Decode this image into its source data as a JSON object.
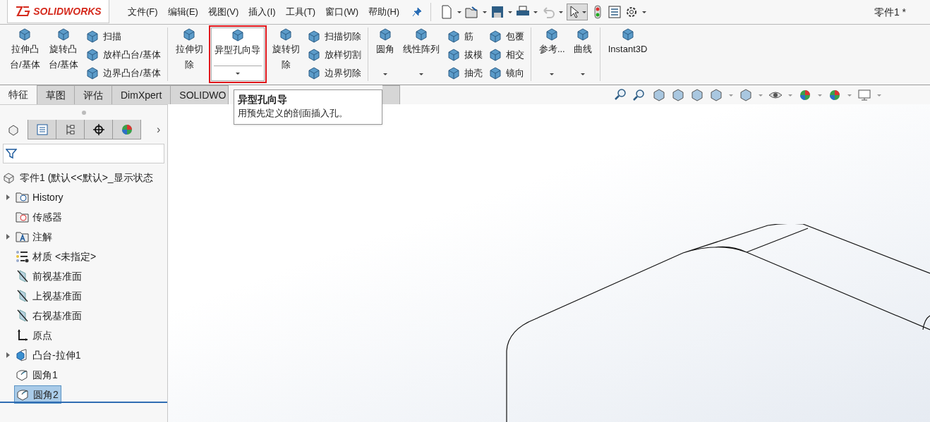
{
  "app": {
    "logo": "SOLIDWORKS",
    "title": "零件1 *"
  },
  "menu": [
    "文件(F)",
    "编辑(E)",
    "视图(V)",
    "插入(I)",
    "工具(T)",
    "窗口(W)",
    "帮助(H)"
  ],
  "ribbon": [
    {
      "kind": "big",
      "lines": [
        "拉伸凸",
        "台/基体"
      ],
      "dropdown": false,
      "hover": false
    },
    {
      "kind": "big",
      "lines": [
        "旋转凸",
        "台/基体"
      ],
      "dropdown": false,
      "hover": false
    },
    {
      "kind": "stack",
      "items": [
        "扫描",
        "放样凸台/基体",
        "边界凸台/基体"
      ]
    },
    {
      "kind": "separator"
    },
    {
      "kind": "big",
      "lines": [
        "拉伸切",
        "除"
      ],
      "dropdown": false,
      "hover": false
    },
    {
      "kind": "big",
      "lines": [
        "异型孔向导"
      ],
      "dropdown": true,
      "hover": true
    },
    {
      "kind": "big",
      "lines": [
        "旋转切",
        "除"
      ],
      "dropdown": false,
      "hover": false
    },
    {
      "kind": "stack",
      "items": [
        "扫描切除",
        "放样切割",
        "边界切除"
      ]
    },
    {
      "kind": "separator"
    },
    {
      "kind": "big",
      "lines": [
        "圆角"
      ],
      "dropdown": true,
      "hover": false
    },
    {
      "kind": "big",
      "lines": [
        "线性阵列"
      ],
      "dropdown": true,
      "hover": false
    },
    {
      "kind": "stack",
      "items": [
        "筋",
        "拔模",
        "抽壳"
      ]
    },
    {
      "kind": "stack",
      "items": [
        "包覆",
        "相交",
        "镜向"
      ]
    },
    {
      "kind": "separator"
    },
    {
      "kind": "big",
      "lines": [
        "参考..."
      ],
      "dropdown": true,
      "hover": false
    },
    {
      "kind": "big",
      "lines": [
        "曲线"
      ],
      "dropdown": true,
      "hover": false
    },
    {
      "kind": "separator"
    },
    {
      "kind": "big",
      "lines": [
        "Instant3D"
      ],
      "dropdown": false,
      "hover": false
    }
  ],
  "tabs": [
    {
      "label": "特征",
      "selected": true
    },
    {
      "label": "草图",
      "selected": false
    },
    {
      "label": "评估",
      "selected": false
    },
    {
      "label": "DimXpert",
      "selected": false
    },
    {
      "label": "SOLIDWO",
      "selected": false
    },
    {
      "selected": false
    }
  ],
  "tooltip": {
    "title": "异型孔向导",
    "description": "用预先定义的剖面插入孔。"
  },
  "panel_chevron": "›",
  "panel_tabs": [
    {
      "kind": "feature",
      "selected": true
    },
    {
      "kind": "property",
      "selected": false
    },
    {
      "kind": "config",
      "selected": false
    },
    {
      "kind": "dimxpert",
      "selected": false
    },
    {
      "kind": "display",
      "selected": false
    }
  ],
  "tree": [
    {
      "kind": "part",
      "label": "零件1  (默认<<默认>_显示状态",
      "selected": false
    },
    {
      "kind": "history",
      "label": "History",
      "collapsed": true,
      "selected": false
    },
    {
      "kind": "sensor",
      "label": "传感器",
      "collapsed": false,
      "selected": false
    },
    {
      "kind": "annotation",
      "label": "注解",
      "collapsed": true,
      "selected": false
    },
    {
      "kind": "material",
      "label": "材质 <未指定>",
      "collapsed": false,
      "selected": false
    },
    {
      "kind": "plane",
      "label": "前视基准面",
      "collapsed": false,
      "selected": false
    },
    {
      "kind": "plane",
      "label": "上视基准面",
      "collapsed": false,
      "selected": false
    },
    {
      "kind": "plane",
      "label": "右视基准面",
      "collapsed": false,
      "selected": false
    },
    {
      "kind": "origin",
      "label": "原点",
      "collapsed": false,
      "selected": false
    },
    {
      "kind": "extrude",
      "label": "凸台-拉伸1",
      "collapsed": true,
      "selected": false
    },
    {
      "kind": "fillet",
      "label": "圆角1",
      "collapsed": false,
      "selected": false
    },
    {
      "kind": "fillet",
      "label": "圆角2",
      "collapsed": false,
      "selected": true
    }
  ]
}
